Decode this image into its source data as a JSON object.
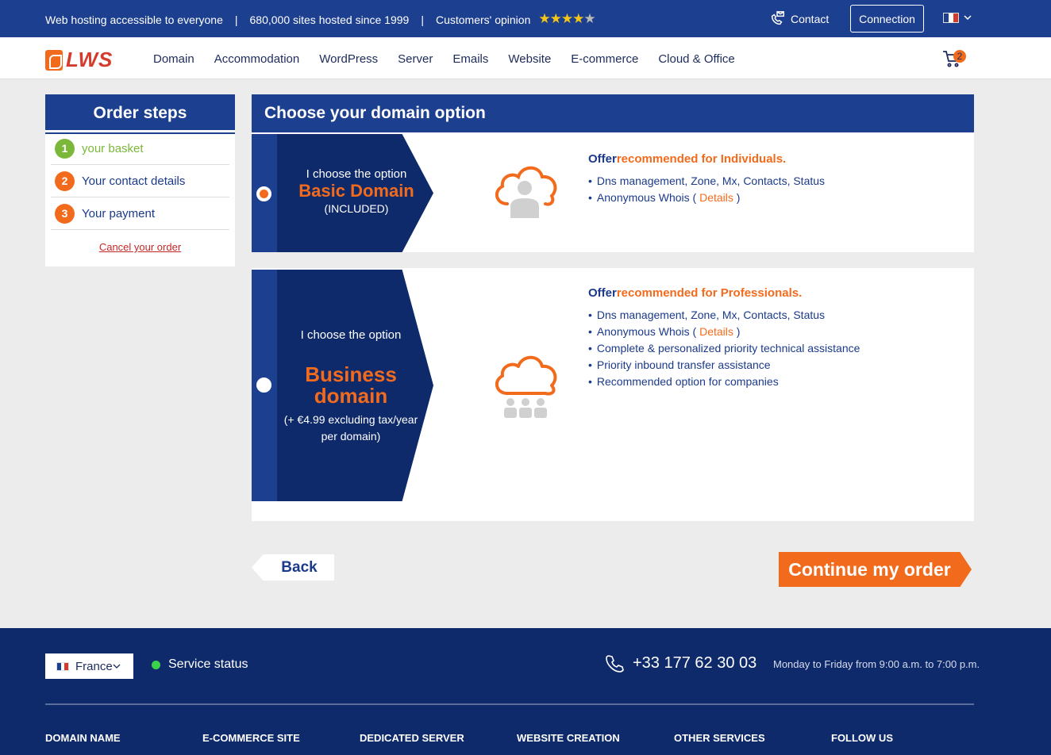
{
  "topbar": {
    "tagline": "Web hosting accessible to everyone",
    "sites": "680,000 sites hosted since 1999",
    "opinion": "Customers' opinion",
    "separator": "|",
    "contact": "Contact",
    "connection": "Connection"
  },
  "nav": {
    "logo": "LWS",
    "items": [
      "Domain",
      "Accommodation",
      "WordPress",
      "Server",
      "Emails",
      "Website",
      "E-commerce",
      "Cloud & Office"
    ],
    "cart_count": "2"
  },
  "steps": {
    "title": "Order steps",
    "items": [
      {
        "num": "1",
        "label": "your basket"
      },
      {
        "num": "2",
        "label": "Your contact details"
      },
      {
        "num": "3",
        "label": "Your payment"
      }
    ],
    "cancel": "Cancel your order"
  },
  "panel": {
    "title": "Choose your domain option",
    "options": [
      {
        "choose": "I choose the option",
        "name": "Basic Domain",
        "price": "(INCLUDED)",
        "offer_prefix": "Offer",
        "offer_highlight": "recommended for Individuals.",
        "features": [
          "Dns management, Zone, Mx, Contacts, Status",
          "Anonymous Whois ("
        ],
        "details": "Details",
        "details_close": ")",
        "selected": true
      },
      {
        "choose": "I choose the option",
        "name": "Business domain",
        "price": "(+ €4.99 excluding tax/year per domain)",
        "offer_prefix": "Offer",
        "offer_highlight": "recommended for Professionals.",
        "features": [
          "Dns management, Zone, Mx, Contacts, Status",
          "Anonymous Whois (",
          "Complete & personalized priority technical assistance",
          "Priority inbound transfer assistance",
          "Recommended option for companies"
        ],
        "details": "Details",
        "details_close": ")",
        "selected": false
      }
    ]
  },
  "buttons": {
    "back": "Back",
    "continue": "Continue my order"
  },
  "footer": {
    "country": "France",
    "status": "Service status",
    "phone": "+33 177 62 30 03",
    "hours": "Monday to Friday from 9:00 a.m. to 7:00 p.m.",
    "columns": [
      "DOMAIN NAME",
      "E-COMMERCE SITE",
      "DEDICATED SERVER",
      "WEBSITE CREATION",
      "OTHER SERVICES",
      "FOLLOW US"
    ]
  },
  "colors": {
    "brand_blue": "#1d3f8f",
    "dark_blue": "#0e2a6b",
    "accent_orange": "#f26b1d",
    "step_green": "#7bb83a"
  },
  "rating_stars": 4.5
}
